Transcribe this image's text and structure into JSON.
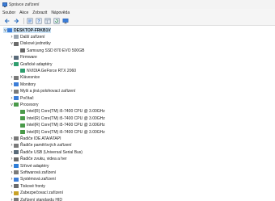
{
  "window": {
    "title": "Správce zařízení"
  },
  "menu": [
    "Soubor",
    "Akce",
    "Zobrazit",
    "Nápověda"
  ],
  "toolbar": {
    "icons": [
      "back-icon",
      "forward-icon",
      "properties-icon",
      "help-icon",
      "view-icon",
      "refresh-icon",
      "monitor-icon"
    ]
  },
  "tree": {
    "root": "DESKTOP-FRKB1V",
    "items": [
      {
        "label": "Další zařízení",
        "icon": "other-devices-icon",
        "color": "#9aa5b1"
      },
      {
        "label": "Diskové jednotky",
        "icon": "disk-drives-icon",
        "color": "#6b6b6b"
      },
      {
        "label": "Samsung SSD 870 EVO 500GB",
        "icon": "disk-icon",
        "color": "#6b6b6b"
      },
      {
        "label": "Firmware",
        "icon": "firmware-icon",
        "color": "#5a6b7a"
      },
      {
        "label": "Grafické adaptéry",
        "icon": "display-adapters-icon",
        "color": "#2f9e6e"
      },
      {
        "label": "NVIDIA GeForce RTX 2060",
        "icon": "gpu-icon",
        "color": "#2f9e6e"
      },
      {
        "label": "Klávesnice",
        "icon": "keyboard-icon",
        "color": "#7a7a7a"
      },
      {
        "label": "Monitory",
        "icon": "monitors-icon",
        "color": "#3b7dd8"
      },
      {
        "label": "Myši a jiná polohovací zařízení",
        "icon": "mouse-icon",
        "color": "#7a7a7a"
      },
      {
        "label": "Počítač",
        "icon": "computer-icon",
        "color": "#3b7dd8"
      },
      {
        "label": "Procesory",
        "icon": "processors-icon",
        "color": "#4a9a4a"
      },
      {
        "label": "Intel(R) Core(TM) i5-7400 CPU @ 3.00GHz",
        "icon": "cpu-icon",
        "color": "#4a9a4a"
      },
      {
        "label": "Intel(R) Core(TM) i5-7400 CPU @ 3.00GHz",
        "icon": "cpu-icon",
        "color": "#4a9a4a"
      },
      {
        "label": "Intel(R) Core(TM) i5-7400 CPU @ 3.00GHz",
        "icon": "cpu-icon",
        "color": "#4a9a4a"
      },
      {
        "label": "Intel(R) Core(TM) i5-7400 CPU @ 3.00GHz",
        "icon": "cpu-icon",
        "color": "#4a9a4a"
      },
      {
        "label": "Řadiče IDE ATA/ATAPI",
        "icon": "ide-controller-icon",
        "color": "#7a7a7a"
      },
      {
        "label": "Řadiče paměťových zařízení",
        "icon": "storage-controller-icon",
        "color": "#7a7a7a"
      },
      {
        "label": "Řadiče USB (Universal Serial Bus)",
        "icon": "usb-icon",
        "color": "#5a6b7a"
      },
      {
        "label": "Řadiče zvuku, videa a her",
        "icon": "audio-icon",
        "color": "#6b6b6b"
      },
      {
        "label": "Síťové adaptéry",
        "icon": "network-icon",
        "color": "#2f7ed8"
      },
      {
        "label": "Softwarová zařízení",
        "icon": "software-devices-icon",
        "color": "#7a7a7a"
      },
      {
        "label": "Systémová zařízení",
        "icon": "system-devices-icon",
        "color": "#3b7dd8"
      },
      {
        "label": "Tiskové fronty",
        "icon": "print-queues-icon",
        "color": "#6b6b6b"
      },
      {
        "label": "Zabezpečovací zařízení",
        "icon": "security-devices-icon",
        "color": "#c9a227"
      },
      {
        "label": "Zařízení standardu HID",
        "icon": "hid-icon",
        "color": "#7a7a7a"
      }
    ]
  }
}
